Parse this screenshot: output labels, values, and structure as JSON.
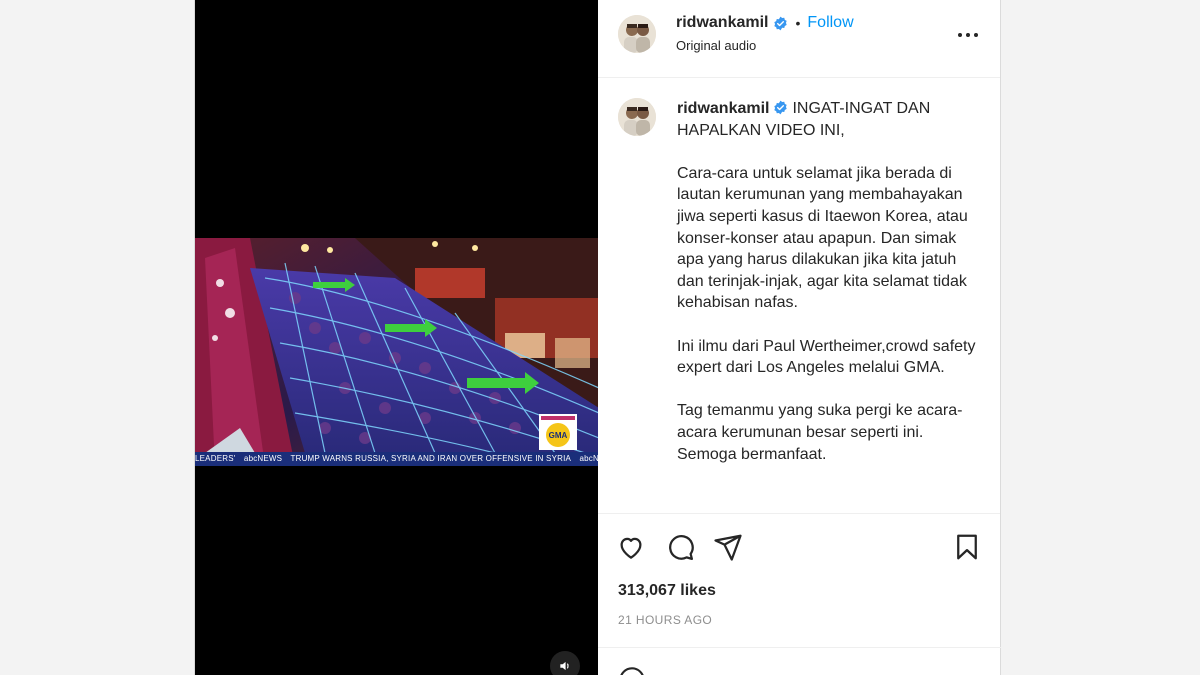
{
  "header": {
    "username": "ridwankamil",
    "separator": "•",
    "follow_label": "Follow",
    "subtitle": "Original audio"
  },
  "caption": {
    "username": "ridwankamil",
    "paragraphs": [
      "INGAT-INGAT DAN HAPALKAN VIDEO INI,",
      "Cara-cara untuk selamat jika berada di lautan kerumunan yang membahayakan jiwa seperti kasus di Itaewon Korea, atau konser-konser atau apapun. Dan simak apa yang harus dilakukan jika kita jatuh dan terinjak-injak, agar kita selamat tidak kehabisan nafas.",
      "Ini ilmu dari Paul Wertheimer,crowd safety expert dari Los Angeles melalui GMA.",
      "Tag temanmu yang suka pergi ke acara-acara kerumunan besar seperti ini. Semoga bermanfaat."
    ]
  },
  "stats": {
    "likes": "313,067 likes",
    "time_ago": "21 HOURS AGO"
  },
  "video": {
    "ticker_items": [
      "LEADERS'",
      "abcNEWS",
      "TRUMP WARNS RUSSIA, SYRIA AND IRAN OVER OFFENSIVE IN SYRIA",
      "abcNEWS"
    ],
    "badge": "GMA"
  },
  "icons": {
    "verified": "verified-badge-icon",
    "more": "more-options-icon",
    "like": "heart-icon",
    "comment": "comment-bubble-icon",
    "share": "paper-plane-icon",
    "save": "bookmark-icon",
    "audio": "speaker-icon",
    "emoji": "emoji-icon"
  },
  "colors": {
    "accent": "#0095f6",
    "verified": "#3897f0",
    "text": "#262626",
    "muted": "#8e8e8e"
  }
}
